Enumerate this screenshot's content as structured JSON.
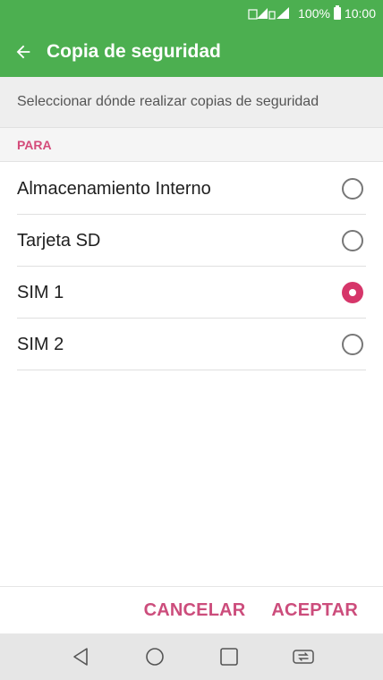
{
  "status_bar": {
    "battery_percent": "100%",
    "time": "10:00"
  },
  "app_bar": {
    "back_icon": "arrow-left-icon",
    "title": "Copia de seguridad"
  },
  "description": "Seleccionar dónde realizar copias de seguridad",
  "section": {
    "header": "PARA"
  },
  "options": [
    {
      "label": "Almacenamiento Interno",
      "selected": false
    },
    {
      "label": "Tarjeta SD",
      "selected": false
    },
    {
      "label": "SIM 1",
      "selected": true
    },
    {
      "label": "SIM 2",
      "selected": false
    }
  ],
  "actions": {
    "cancel": "CANCELAR",
    "accept": "ACEPTAR"
  },
  "nav_bar": {
    "icons": [
      "back-triangle-icon",
      "home-circle-icon",
      "recents-square-icon",
      "dual-window-icon"
    ]
  },
  "colors": {
    "primary": "#4caf50",
    "accent": "#d6366a",
    "section_header": "#d44b7a"
  }
}
